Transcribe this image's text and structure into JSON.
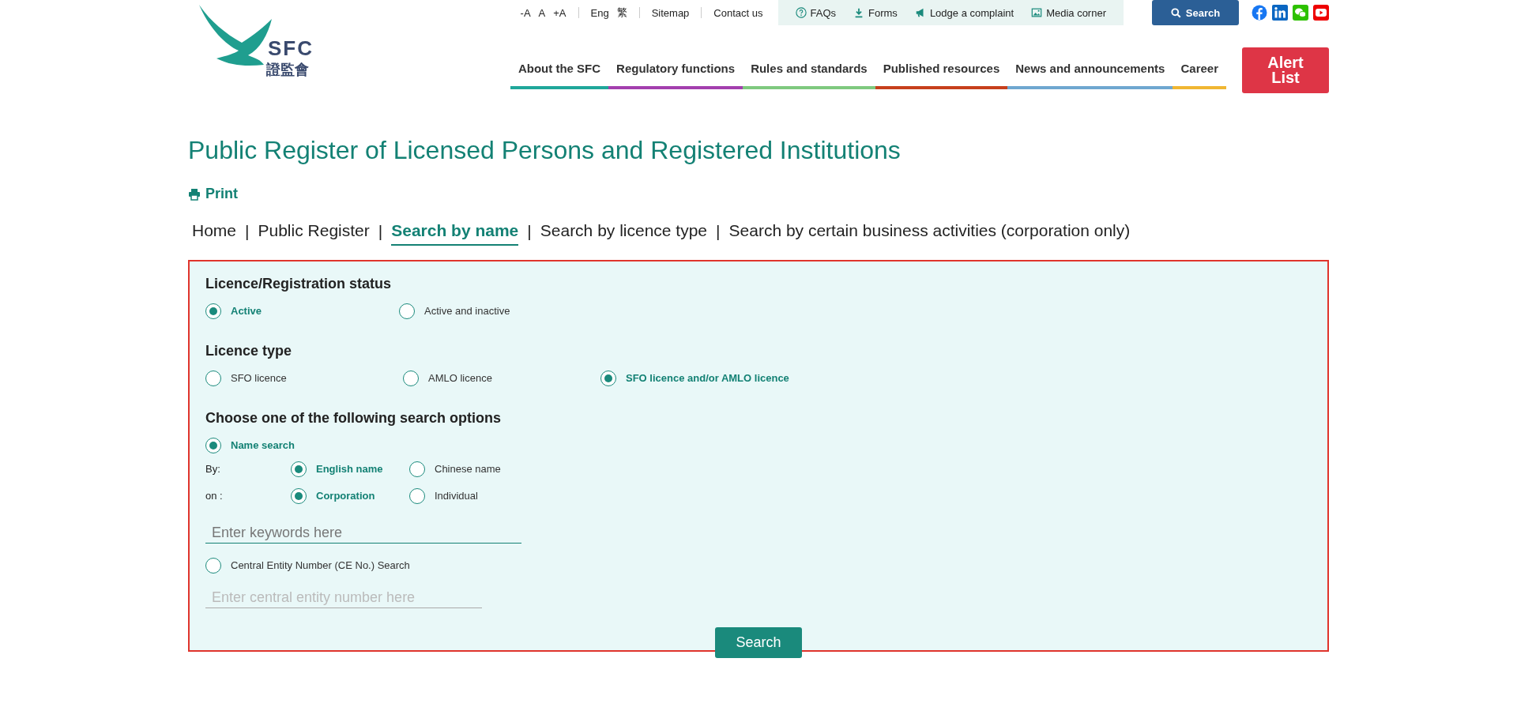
{
  "header": {
    "logo": {
      "abbr": "SFC",
      "chinese": "證監會"
    },
    "font_size_controls": [
      "-A",
      "A",
      "+A"
    ],
    "languages": [
      "Eng",
      "繁"
    ],
    "links": [
      "Sitemap",
      "Contact us"
    ],
    "quick_links": [
      {
        "kind": "faq",
        "label": "FAQs"
      },
      {
        "kind": "download",
        "label": "Forms"
      },
      {
        "kind": "megaphone",
        "label": "Lodge a complaint"
      },
      {
        "kind": "image",
        "label": "Media corner"
      }
    ],
    "search_button": "Search",
    "nav": [
      {
        "label": "About the SFC",
        "color": "#1fa79a"
      },
      {
        "label": "Regulatory functions",
        "color": "#a33fae"
      },
      {
        "label": "Rules and standards",
        "color": "#7fc97f"
      },
      {
        "label": "Published resources",
        "color": "#c7401c"
      },
      {
        "label": "News and announcements",
        "color": "#6fa7d0"
      },
      {
        "label": "Career",
        "color": "#f0b632"
      }
    ],
    "alert_button": "Alert List"
  },
  "page_title": "Public Register of Licensed Persons and Registered Institutions",
  "print_link": "Print",
  "breadcrumb_separator": "|",
  "breadcrumb": [
    {
      "label": "Home",
      "selected": false
    },
    {
      "label": "Public Register",
      "selected": false
    },
    {
      "label": "Search by name",
      "selected": true
    },
    {
      "label": "Search by licence type",
      "selected": false
    },
    {
      "label": "Search by certain business activities (corporation only)",
      "selected": false
    }
  ],
  "form": {
    "status": {
      "heading": "Licence/Registration status",
      "options": [
        {
          "label": "Active",
          "selected": true
        },
        {
          "label": "Active and inactive",
          "selected": false
        }
      ]
    },
    "licence_type": {
      "heading": "Licence type",
      "options": [
        {
          "label": "SFO licence",
          "selected": false
        },
        {
          "label": "AMLO licence",
          "selected": false
        },
        {
          "label": "SFO licence and/or AMLO licence",
          "selected": true
        }
      ]
    },
    "search_options": {
      "heading": "Choose one of the following search options",
      "name_search": {
        "label": "Name search",
        "selected": true,
        "by": {
          "label": "By:",
          "options": [
            {
              "label": "English name",
              "selected": true
            },
            {
              "label": "Chinese name",
              "selected": false
            }
          ]
        },
        "on": {
          "label": "on :",
          "options": [
            {
              "label": "Corporation",
              "selected": true
            },
            {
              "label": "Individual",
              "selected": false
            }
          ]
        },
        "keyword_field": {
          "placeholder": "Enter keywords here"
        }
      },
      "ce_search": {
        "label": "Central Entity Number (CE No.) Search",
        "selected": false,
        "ce_field": {
          "placeholder": "Enter central entity number here"
        }
      }
    },
    "search_button": "Search"
  }
}
